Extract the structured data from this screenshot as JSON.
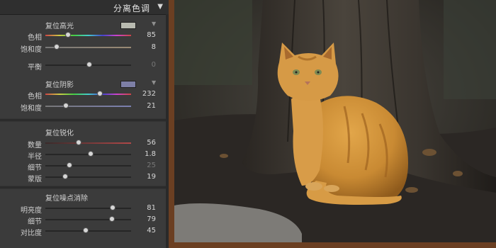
{
  "header": {
    "title": "分离色调",
    "arrow": "▼"
  },
  "split_toning": {
    "highlights": {
      "title": "复位高光",
      "swatch_color": "#b8bab0",
      "rows": [
        {
          "label": "色相",
          "value": "85",
          "pos": 0.26,
          "track": "hue"
        },
        {
          "label": "饱和度",
          "value": "8",
          "pos": 0.12,
          "track": "sat_hi"
        }
      ]
    },
    "balance": {
      "label": "平衡",
      "value": "0",
      "pos": 0.5
    },
    "shadows": {
      "title": "复位阴影",
      "swatch_color": "#7d7fa6",
      "rows": [
        {
          "label": "色相",
          "value": "232",
          "pos": 0.63,
          "track": "hue"
        },
        {
          "label": "饱和度",
          "value": "21",
          "pos": 0.23,
          "track": "sat_sh"
        }
      ]
    }
  },
  "sharpening": {
    "title": "复位锐化",
    "rows": [
      {
        "label": "数量",
        "value": "56",
        "pos": 0.38,
        "track": "red"
      },
      {
        "label": "半径",
        "value": "1.8",
        "pos": 0.52,
        "track": "plain"
      },
      {
        "label": "细节",
        "value": "25",
        "pos": 0.27,
        "track": "plain",
        "dim": true
      },
      {
        "label": "蒙版",
        "value": "19",
        "pos": 0.22,
        "track": "plain"
      }
    ]
  },
  "noise_reduction": {
    "title": "复位噪点消除",
    "rows": [
      {
        "label": "明亮度",
        "value": "81",
        "pos": 0.78,
        "track": "plain"
      },
      {
        "label": "细节",
        "value": "79",
        "pos": 0.77,
        "track": "plain"
      },
      {
        "label": "对比度",
        "value": "45",
        "pos": 0.46,
        "track": "plain"
      }
    ]
  }
}
